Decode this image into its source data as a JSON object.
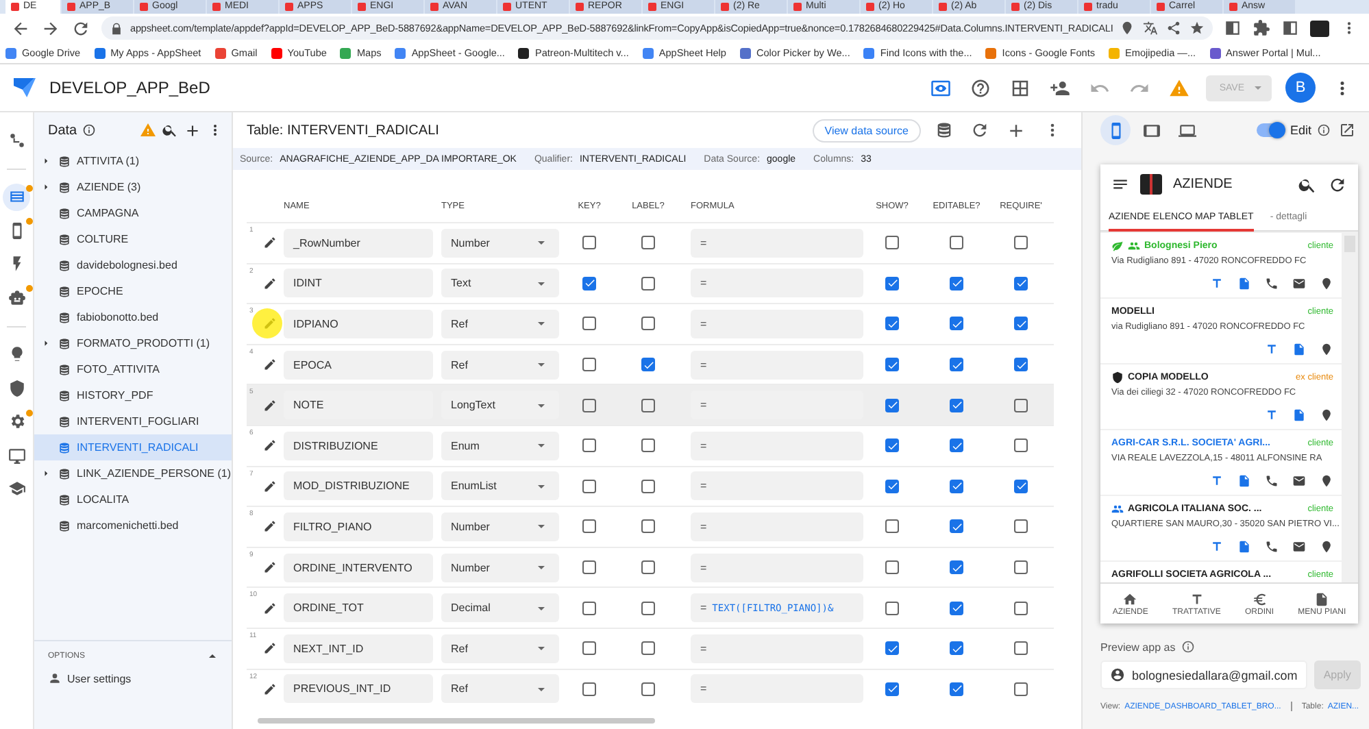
{
  "browser": {
    "tabs": [
      {
        "label": "DE",
        "selected": true
      },
      {
        "label": "APP_B",
        "selected": false
      },
      {
        "label": "Googl",
        "selected": false
      },
      {
        "label": "MEDI",
        "selected": false
      },
      {
        "label": "APPS",
        "selected": false
      },
      {
        "label": "ENGI",
        "selected": false
      },
      {
        "label": "AVAN",
        "selected": false
      },
      {
        "label": "UTENT",
        "selected": false
      },
      {
        "label": "REPOR",
        "selected": false
      },
      {
        "label": "ENGI",
        "selected": false
      },
      {
        "label": "(2) Re",
        "selected": false
      },
      {
        "label": "Multi",
        "selected": false
      },
      {
        "label": "(2) Ho",
        "selected": false
      },
      {
        "label": "(2) Ab",
        "selected": false
      },
      {
        "label": "(2) Dis",
        "selected": false
      },
      {
        "label": "tradu",
        "selected": false
      },
      {
        "label": "Carrel",
        "selected": false
      },
      {
        "label": "Answ",
        "selected": false
      }
    ],
    "url": "appsheet.com/template/appdef?appId=DEVELOP_APP_BeD-5887692&appName=DEVELOP_APP_BeD-5887692&linkFrom=CopyApp&isCopiedApp=true&nonce=0.1782684680229425#Data.Columns.INTERVENTI_RADICALI",
    "bookmarks": [
      "Google Drive",
      "My Apps - AppSheet",
      "Gmail",
      "YouTube",
      "Maps",
      "AppSheet - Google...",
      "Patreon-Multitech v...",
      "AppSheet Help",
      "Color Picker by We...",
      "Find Icons with the...",
      "Icons - Google Fonts",
      "Emojipedia —...",
      "Answer Portal | Mul..."
    ]
  },
  "app_header": {
    "title": "DEVELOP_APP_BeD",
    "save": {
      "label": "SAVE",
      "disabled": true
    },
    "avatar": "B"
  },
  "rail": [
    {
      "kind": "flow",
      "selected": false,
      "alert": false
    },
    {
      "kind": "data",
      "selected": true,
      "alert": true
    },
    {
      "kind": "views",
      "selected": false,
      "alert": true
    },
    {
      "kind": "actions",
      "selected": false,
      "alert": false
    },
    {
      "kind": "bots",
      "selected": false,
      "alert": true
    },
    {
      "kind": "intelligence",
      "selected": false,
      "alert": false
    },
    {
      "kind": "security",
      "selected": false,
      "alert": false
    },
    {
      "kind": "settings",
      "selected": false,
      "alert": true
    },
    {
      "kind": "monitor",
      "selected": false,
      "alert": false
    },
    {
      "kind": "learn",
      "selected": false,
      "alert": false
    }
  ],
  "sidebar": {
    "title": "Data",
    "items": [
      {
        "label": "ATTIVITA (1)",
        "expandable": true,
        "selected": false
      },
      {
        "label": "AZIENDE (3)",
        "expandable": true,
        "selected": false
      },
      {
        "label": "CAMPAGNA",
        "expandable": false,
        "selected": false
      },
      {
        "label": "COLTURE",
        "expandable": false,
        "selected": false
      },
      {
        "label": "davidebolognesi.bed",
        "expandable": false,
        "selected": false
      },
      {
        "label": "EPOCHE",
        "expandable": false,
        "selected": false
      },
      {
        "label": "fabiobonotto.bed",
        "expandable": false,
        "selected": false
      },
      {
        "label": "FORMATO_PRODOTTI (1)",
        "expandable": true,
        "selected": false
      },
      {
        "label": "FOTO_ATTIVITA",
        "expandable": false,
        "selected": false
      },
      {
        "label": "HISTORY_PDF",
        "expandable": false,
        "selected": false
      },
      {
        "label": "INTERVENTI_FOGLIARI",
        "expandable": false,
        "selected": false
      },
      {
        "label": "INTERVENTI_RADICALI",
        "expandable": false,
        "selected": true
      },
      {
        "label": "LINK_AZIENDE_PERSONE (1)",
        "expandable": true,
        "selected": false
      },
      {
        "label": "LOCALITA",
        "expandable": false,
        "selected": false
      },
      {
        "label": "marcomenichetti.bed",
        "expandable": false,
        "selected": false
      }
    ],
    "options_title": "OPTIONS",
    "options_items": [
      "User settings"
    ]
  },
  "table": {
    "title": "Table: INTERVENTI_RADICALI",
    "view_source": "View data source",
    "meta": [
      {
        "label": "Source:",
        "value": "ANAGRAFICHE_AZIENDE_APP_DA IMPORTARE_OK"
      },
      {
        "label": "Qualifier:",
        "value": "INTERVENTI_RADICALI"
      },
      {
        "label": "Data Source:",
        "value": "google"
      },
      {
        "label": "Columns:",
        "value": "33"
      }
    ],
    "columns": [
      "NAME",
      "TYPE",
      "KEY?",
      "LABEL?",
      "FORMULA",
      "SHOW?",
      "EDITABLE?",
      "REQUIRE'"
    ],
    "rows": [
      {
        "number": "1",
        "name": "_RowNumber",
        "type": "Number",
        "key": false,
        "label": false,
        "formula": "",
        "show": false,
        "editable": false,
        "required": false,
        "highlighted": false,
        "marked": false
      },
      {
        "number": "2",
        "name": "IDINT",
        "type": "Text",
        "key": true,
        "label": false,
        "formula": "",
        "show": true,
        "editable": true,
        "required": true,
        "highlighted": false,
        "marked": false
      },
      {
        "number": "3",
        "name": "IDPIANO",
        "type": "Ref",
        "key": false,
        "label": false,
        "formula": "",
        "show": true,
        "editable": true,
        "required": true,
        "highlighted": false,
        "marked": true
      },
      {
        "number": "4",
        "name": "EPOCA",
        "type": "Ref",
        "key": false,
        "label": true,
        "formula": "",
        "show": true,
        "editable": true,
        "required": true,
        "highlighted": false,
        "marked": false
      },
      {
        "number": "5",
        "name": "NOTE",
        "type": "LongText",
        "key": false,
        "label": false,
        "formula": "",
        "show": true,
        "editable": true,
        "required": false,
        "highlighted": true,
        "marked": false
      },
      {
        "number": "6",
        "name": "DISTRIBUZIONE",
        "type": "Enum",
        "key": false,
        "label": false,
        "formula": "",
        "show": true,
        "editable": true,
        "required": false,
        "highlighted": false,
        "marked": false
      },
      {
        "number": "7",
        "name": "MOD_DISTRIBUZIONE",
        "type": "EnumList",
        "key": false,
        "label": false,
        "formula": "",
        "show": true,
        "editable": true,
        "required": true,
        "highlighted": false,
        "marked": false
      },
      {
        "number": "8",
        "name": "FILTRO_PIANO",
        "type": "Number",
        "key": false,
        "label": false,
        "formula": "",
        "show": false,
        "editable": true,
        "required": false,
        "highlighted": false,
        "marked": false
      },
      {
        "number": "9",
        "name": "ORDINE_INTERVENTO",
        "type": "Number",
        "key": false,
        "label": false,
        "formula": "",
        "show": false,
        "editable": true,
        "required": false,
        "highlighted": false,
        "marked": false
      },
      {
        "number": "10",
        "name": "ORDINE_TOT",
        "type": "Decimal",
        "key": false,
        "label": false,
        "formula": "TEXT([FILTRO_PIANO])&",
        "show": false,
        "editable": true,
        "required": false,
        "highlighted": false,
        "marked": false
      },
      {
        "number": "11",
        "name": "NEXT_INT_ID",
        "type": "Ref",
        "key": false,
        "label": false,
        "formula": "",
        "show": true,
        "editable": true,
        "required": false,
        "highlighted": false,
        "marked": false
      },
      {
        "number": "12",
        "name": "PREVIOUS_INT_ID",
        "type": "Ref",
        "key": false,
        "label": false,
        "formula": "",
        "show": true,
        "editable": true,
        "required": false,
        "highlighted": false,
        "marked": false
      }
    ],
    "formula_prefix": "="
  },
  "preview": {
    "devices": [
      {
        "kind": "phone",
        "selected": true
      },
      {
        "kind": "tablet",
        "selected": false
      },
      {
        "kind": "desktop",
        "selected": false
      }
    ],
    "edit_toggle": {
      "label": "Edit",
      "on": true
    },
    "app": {
      "title": "AZIENDE",
      "tabs": [
        {
          "label": "AZIENDE ELENCO MAP TABLET",
          "selected": true
        },
        {
          "label": "- dettagli",
          "selected": false
        }
      ],
      "records": [
        {
          "title": "Bolognesi Piero",
          "color": "#2eb82e",
          "badges": [
            {
              "kind": "leaf"
            },
            {
              "kind": "group"
            }
          ],
          "status": {
            "label": "cliente",
            "color": "#2eb82e"
          },
          "address": "Via Rudigliano 891 - 47020 RONCOFREDDO FC",
          "actions": [
            {
              "kind": "text"
            },
            {
              "kind": "doc"
            },
            {
              "kind": "phone"
            },
            {
              "kind": "mail"
            },
            {
              "kind": "place"
            }
          ]
        },
        {
          "title": "MODELLI",
          "color": "#222222",
          "status": {
            "label": "cliente",
            "color": "#2eb82e"
          },
          "address": "via Rudigliano 891 - 47020 RONCOFREDDO FC",
          "actions": [
            {
              "kind": "text"
            },
            {
              "kind": "doc"
            },
            {
              "kind": "place"
            }
          ]
        },
        {
          "title": "COPIA MODELLO",
          "color": "#222222",
          "badges": [
            {
              "kind": "shield"
            }
          ],
          "status": {
            "label": "ex cliente",
            "color": "#e8890c"
          },
          "address": "Via dei ciliegi 32 - 47020 RONCOFREDDO FC",
          "actions": [
            {
              "kind": "text"
            },
            {
              "kind": "doc"
            },
            {
              "kind": "place"
            }
          ]
        },
        {
          "title": "AGRI-CAR S.R.L. SOCIETA' AGRI...",
          "color": "#1a73e8",
          "status": {
            "label": "cliente",
            "color": "#2eb82e"
          },
          "address": "VIA REALE LAVEZZOLA,15 - 48011 ALFONSINE RA",
          "actions": [
            {
              "kind": "text"
            },
            {
              "kind": "doc"
            },
            {
              "kind": "phone"
            },
            {
              "kind": "mail"
            },
            {
              "kind": "place"
            }
          ]
        },
        {
          "title": "AGRICOLA ITALIANA SOC. ...",
          "color": "#222222",
          "badges": [
            {
              "kind": "group"
            }
          ],
          "status": {
            "label": "cliente",
            "color": "#2eb82e"
          },
          "address": "QUARTIERE SAN MAURO,30 - 35020 SAN PIETRO VI...",
          "actions": [
            {
              "kind": "text"
            },
            {
              "kind": "doc"
            },
            {
              "kind": "phone"
            },
            {
              "kind": "mail"
            },
            {
              "kind": "place"
            }
          ]
        },
        {
          "title": "AGRIFOLLI SOCIETA AGRICOLA ...",
          "color": "#222222",
          "status": {
            "label": "cliente",
            "color": "#2eb82e"
          }
        }
      ],
      "nav": [
        {
          "kind": "home",
          "label": "AZIENDE"
        },
        {
          "kind": "text",
          "label": "TRATTATIVE"
        },
        {
          "kind": "euro",
          "label": "ORDINI"
        },
        {
          "kind": "doc",
          "label": "MENU PIANI"
        }
      ]
    },
    "preview_as_label": "Preview app as",
    "email": "bolognesiedallara@gmail.com",
    "apply": {
      "label": "Apply",
      "disabled": true
    },
    "view_label": "View:",
    "view_value": "AZIENDE_DASHBOARD_TABLET_BRO...",
    "table_label": "Table:",
    "table_value": "AZIEN..."
  }
}
